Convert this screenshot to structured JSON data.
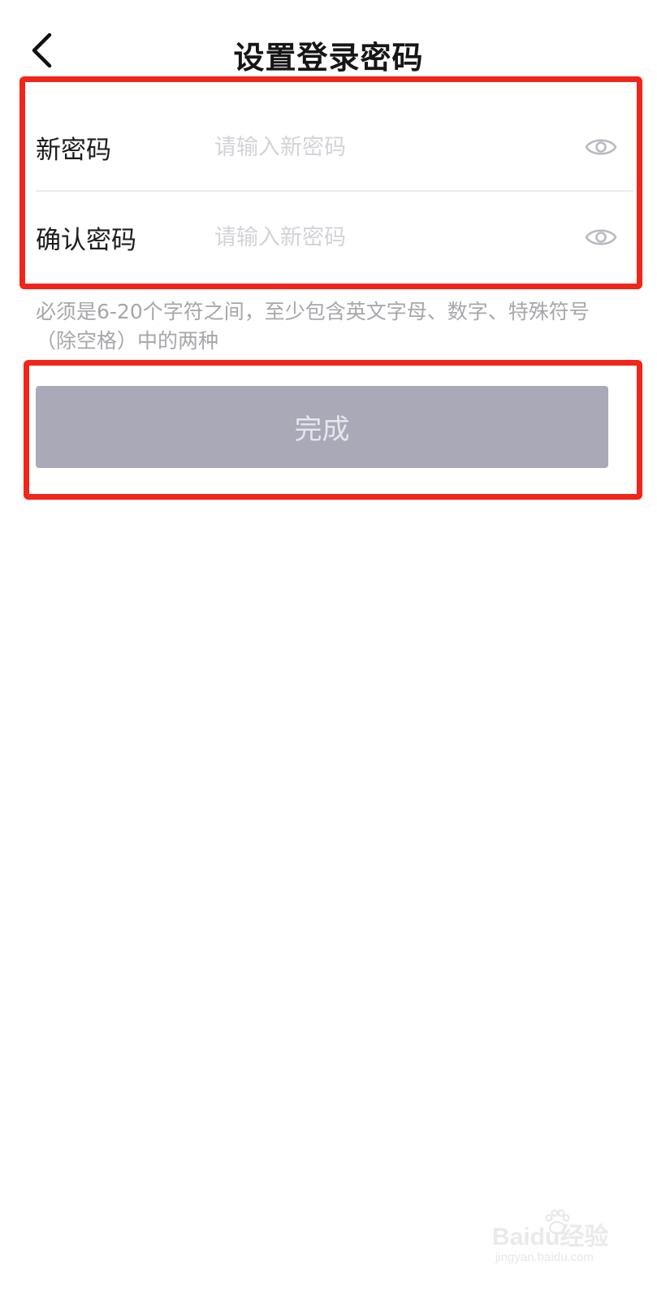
{
  "header": {
    "title": "设置登录密码",
    "back_icon": "chevron-left-icon"
  },
  "form": {
    "new_password": {
      "label": "新密码",
      "placeholder": "请输入新密码",
      "value": "",
      "visibility_icon": "eye-icon"
    },
    "confirm_password": {
      "label": "确认密码",
      "placeholder": "请输入新密码",
      "value": "",
      "visibility_icon": "eye-icon"
    }
  },
  "hint": "必须是6-20个字符之间，至少包含英文字母、数字、特殊符号（除空格）中的两种",
  "submit": {
    "label": "完成",
    "enabled": false
  },
  "annotation_color": "#f2251b",
  "watermark": {
    "brand": "Baidu经验",
    "url": "jingyan.baidu.com"
  }
}
